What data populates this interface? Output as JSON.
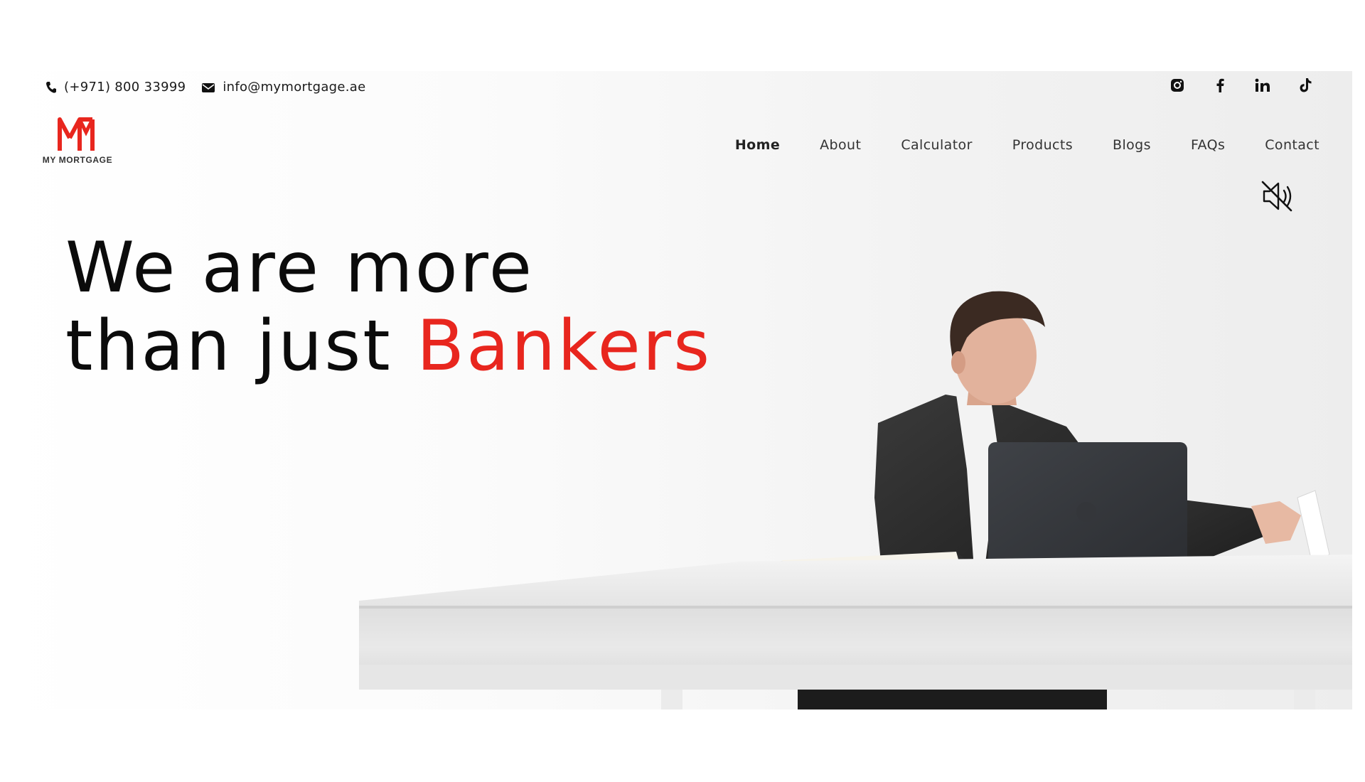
{
  "contact": {
    "phone": "(+971) 800 33999",
    "email": "info@mymortgage.ae"
  },
  "socials": [
    {
      "name": "instagram",
      "icon": "instagram-icon"
    },
    {
      "name": "facebook",
      "icon": "facebook-icon"
    },
    {
      "name": "linkedin",
      "icon": "linkedin-icon"
    },
    {
      "name": "tiktok",
      "icon": "tiktok-icon"
    }
  ],
  "logo": {
    "mark": "M",
    "text": "MY MORTGAGE"
  },
  "nav": {
    "items": [
      {
        "label": "Home",
        "active": true
      },
      {
        "label": "About"
      },
      {
        "label": "Calculator"
      },
      {
        "label": "Products"
      },
      {
        "label": "Blogs"
      },
      {
        "label": "FAQs"
      },
      {
        "label": "Contact"
      }
    ]
  },
  "hero": {
    "line1": "We are more",
    "line2_prefix": "than just ",
    "line2_accent": "Bankers",
    "mute_icon": "speaker-muted-icon"
  },
  "colors": {
    "accent": "#e8261e",
    "text": "#0b0b0b",
    "nav_text": "#333333"
  }
}
